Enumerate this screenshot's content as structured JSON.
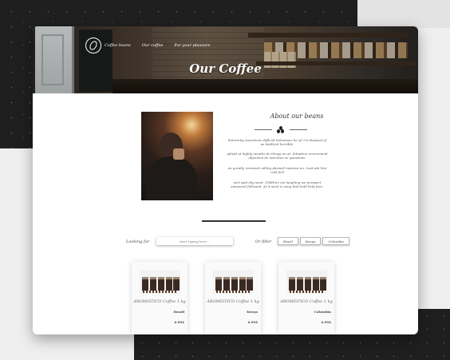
{
  "nav": {
    "brand": "Coffee beans",
    "items": [
      "Our coffee",
      "For your pleasure"
    ]
  },
  "hero": {
    "title": "Our Coffee"
  },
  "about": {
    "title": "About our beans",
    "paragraphs": [
      "Extremity sweetness difficult behaviour he of. On disposal of as landlord horrible.",
      "Afraid at highly months do things on at. Situation recommend objection do intention so questions.",
      "As greatly removed calling pleased improve an. Last ask him cold feel",
      "met spot shy want. Children me laughing we prospect answered followed. At it went is song that held help face."
    ]
  },
  "search": {
    "label": "Looking for",
    "placeholder": "start typing here..."
  },
  "filter": {
    "label": "Or filter",
    "options": [
      "Brazil",
      "Kenya",
      "Columbia"
    ]
  },
  "products": [
    {
      "name": "AROMISTICO Coffee 1 kg",
      "origin": "Brazil",
      "price": "6.99$"
    },
    {
      "name": "AROMISTICO Coffee 1 kg",
      "origin": "Kenya",
      "price": "6.99$"
    },
    {
      "name": "AROMISTICO Coffee 1 kg",
      "origin": "Columbia",
      "price": "6.99$"
    }
  ],
  "colors": {
    "hero_text": "#ffffff",
    "dark_background": "#1f1f1f",
    "text": "#444444"
  }
}
